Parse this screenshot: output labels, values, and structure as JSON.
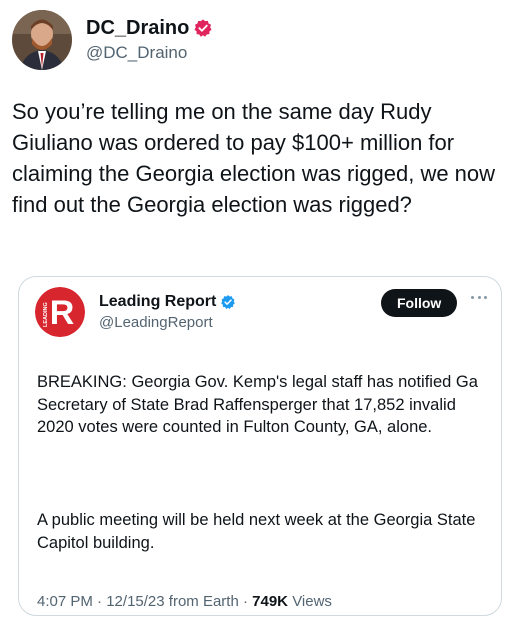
{
  "outer_tweet": {
    "author": {
      "display_name": "DC_Draino",
      "handle": "@DC_Draino",
      "verified": true
    },
    "text": "So you’re telling me on the same day Rudy Giuliano was ordered to pay $100+ million for claiming the Georgia election was rigged, we now find out the Georgia election was rigged?"
  },
  "quoted_tweet": {
    "author": {
      "display_name": "Leading Report",
      "handle": "@LeadingReport",
      "verified": true,
      "avatar_letter": "R",
      "avatar_side_text": "LEADING"
    },
    "follow_label": "Follow",
    "text_paragraph_1": "BREAKING: Georgia Gov. Kemp's legal staff has notified Ga Secretary of State Brad Raffensperger that 17,852 invalid 2020 votes were counted in Fulton County, GA, alone.",
    "text_paragraph_2": "A public meeting will be held next week at the Georgia State Capitol building.",
    "meta": {
      "time": "4:07 PM",
      "date": "12/15/23",
      "source": "from Earth",
      "separator": "·",
      "views_count": "749K",
      "views_label": "Views"
    }
  },
  "colors": {
    "text_primary": "#0f1419",
    "text_secondary": "#536471",
    "verified_badge": "#e0245e",
    "verified_badge_blue": "#1d9bf0",
    "follow_button_bg": "#0f1419",
    "card_border": "#cfd9de",
    "leading_report_red": "#d7262e"
  },
  "icons": {
    "outer_verified": "verified-badge-icon",
    "quote_verified": "verified-badge-icon",
    "more": "more-options-icon"
  }
}
